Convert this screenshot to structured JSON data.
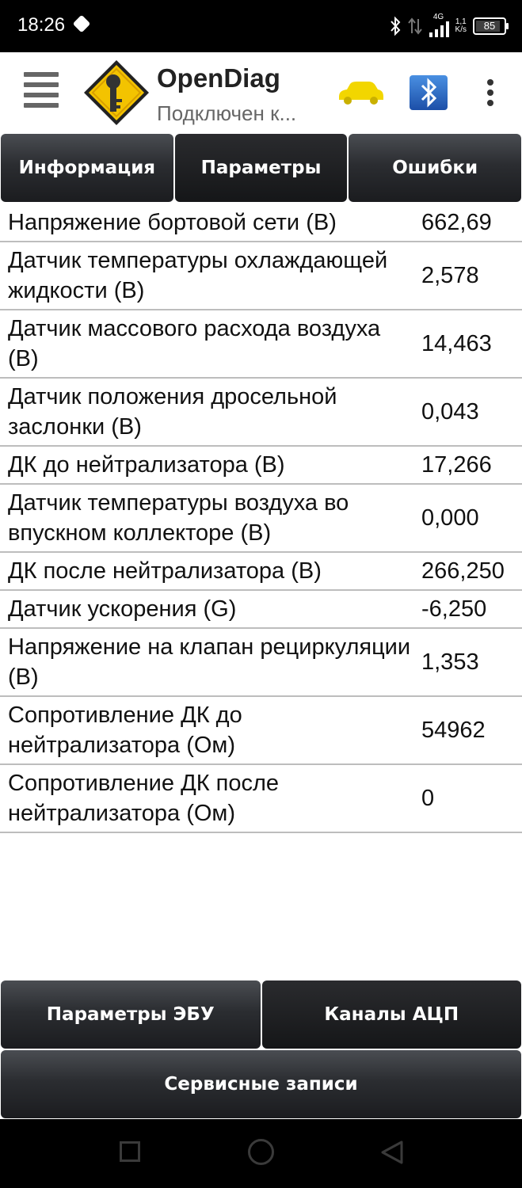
{
  "status_bar": {
    "time": "18:26",
    "network_type": "4G",
    "speed_value": "1,1",
    "speed_unit": "K/s",
    "battery": "85"
  },
  "app_bar": {
    "title": "OpenDiag",
    "subtitle": "Подключен к...",
    "icons": [
      "menu-icon",
      "opendiag-logo",
      "car-icon",
      "bluetooth-icon",
      "overflow-menu-icon"
    ],
    "car_color": "#f2d600"
  },
  "tabs": [
    {
      "label": "Информация",
      "active": false
    },
    {
      "label": "Параметры",
      "active": true
    },
    {
      "label": "Ошибки",
      "active": false
    }
  ],
  "parameters": [
    {
      "name": "Напряжение бортовой сети (В)",
      "value": "662,69"
    },
    {
      "name": "Датчик температуры охлаждающей жидкости (В)",
      "value": "2,578"
    },
    {
      "name": "Датчик массового расхода воздуха (В)",
      "value": "14,463"
    },
    {
      "name": "Датчик положения дросельной заслонки (В)",
      "value": "0,043"
    },
    {
      "name": "ДК до нейтрализатора (В)",
      "value": "17,266"
    },
    {
      "name": "Датчик температуры воздуха во впускном коллекторе (В)",
      "value": "0,000"
    },
    {
      "name": "ДК после нейтрализатора (В)",
      "value": "266,250"
    },
    {
      "name": "Датчик ускорения (G)",
      "value": "-6,250"
    },
    {
      "name": "Напряжение на клапан рециркуляции (В)",
      "value": "1,353"
    },
    {
      "name": "Сопротивление ДК до нейтрализатора (Ом)",
      "value": "54962"
    },
    {
      "name": "Сопротивление ДК после нейтрализатора (Ом)",
      "value": "0"
    }
  ],
  "bottom_tabs": [
    {
      "label": "Параметры ЭБУ",
      "active": false
    },
    {
      "label": "Каналы АЦП",
      "active": true
    }
  ],
  "service_button": "Сервисные записи",
  "nav_bar": {
    "icons": [
      "recent-apps-icon",
      "home-icon",
      "back-icon"
    ]
  }
}
